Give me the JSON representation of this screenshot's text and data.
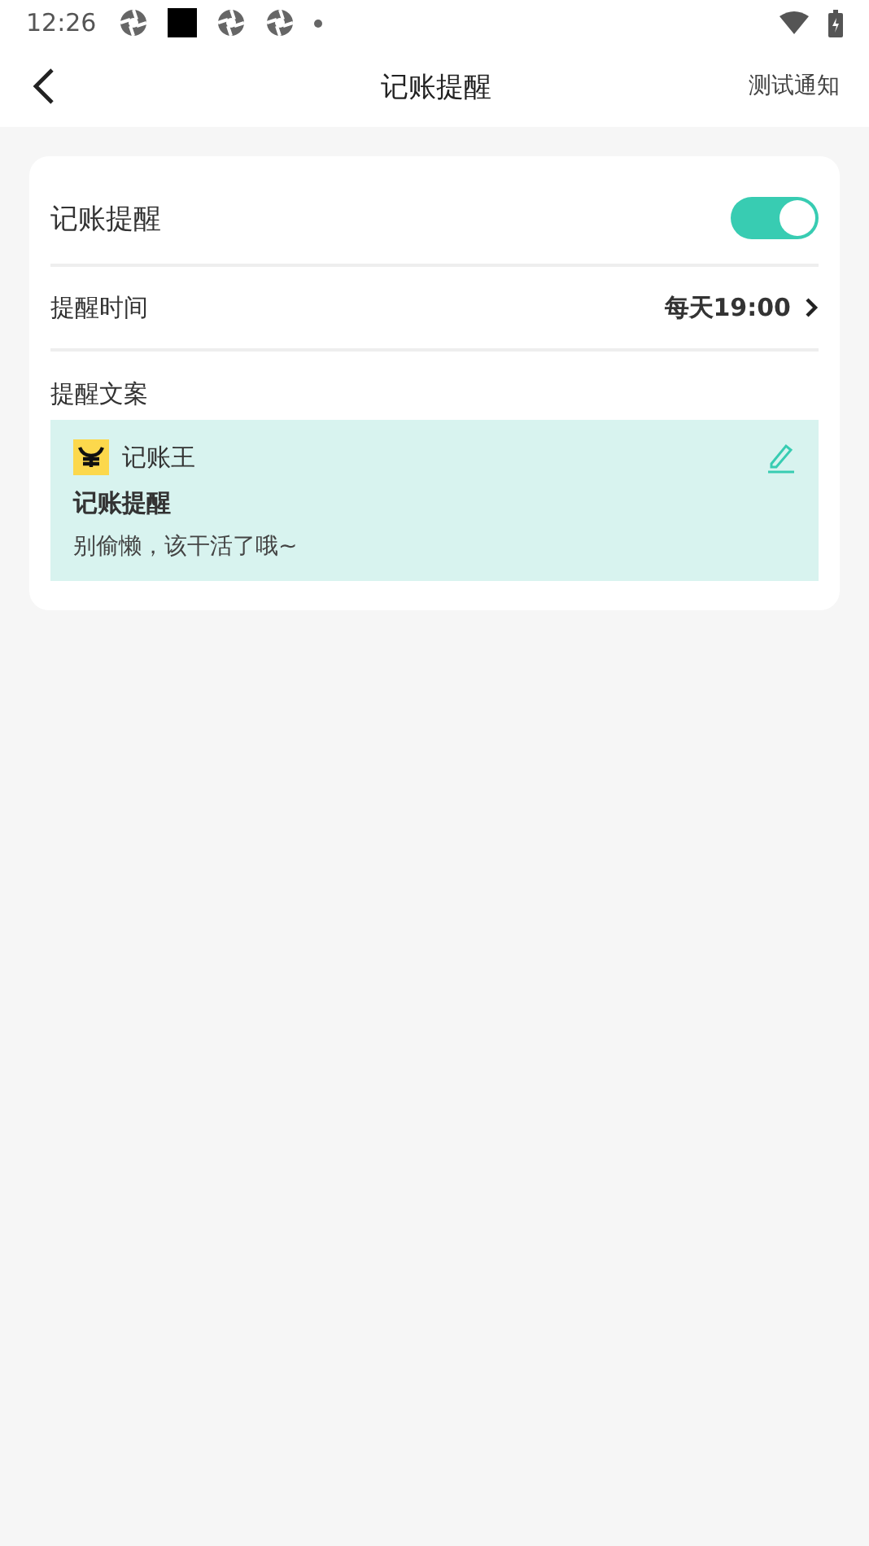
{
  "status_bar": {
    "time": "12:26"
  },
  "header": {
    "title": "记账提醒",
    "action": "测试通知"
  },
  "reminder_switch": {
    "label": "记账提醒",
    "on": true
  },
  "reminder_time": {
    "label": "提醒时间",
    "value": "每天19:00"
  },
  "message": {
    "label": "提醒文案",
    "app_name": "记账王",
    "title": "记账提醒",
    "body": "别偷懒，该干活了哦~"
  }
}
